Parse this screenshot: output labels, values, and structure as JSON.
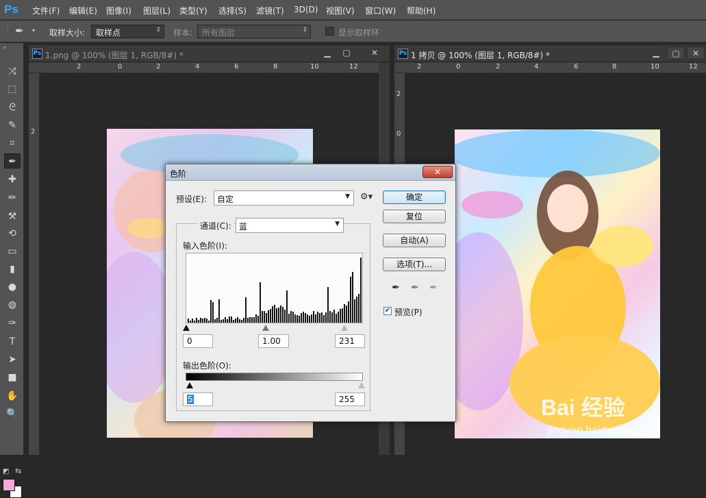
{
  "app": {
    "logo": "Ps"
  },
  "menu": [
    "文件(F)",
    "编辑(E)",
    "图像(I)",
    "图层(L)",
    "类型(Y)",
    "选择(S)",
    "滤镜(T)",
    "3D(D)",
    "视图(V)",
    "窗口(W)",
    "帮助(H)"
  ],
  "options": {
    "sample_size_label": "取样大小:",
    "sample_size_value": "取样点",
    "sample_label": "样本:",
    "sample_value": "所有图层",
    "show_ring_label": "显示取样环"
  },
  "tools": [
    "move-tool",
    "marquee-tool",
    "lasso-tool",
    "quick-select-tool",
    "crop-tool",
    "eyedropper-tool",
    "healing-brush-tool",
    "brush-tool",
    "clone-stamp-tool",
    "history-brush-tool",
    "eraser-tool",
    "gradient-tool",
    "blur-tool",
    "dodge-tool",
    "pen-tool",
    "type-tool",
    "path-select-tool",
    "rectangle-tool",
    "hand-tool",
    "zoom-tool"
  ],
  "tool_glyphs": [
    "⤨",
    "⬚",
    "ᘓ",
    "✎",
    "⌗",
    "✒",
    "✚",
    "✏",
    "⚒",
    "⟲",
    "▭",
    "▮",
    "●",
    "◍",
    "✑",
    "T",
    "➤",
    "■",
    "✋",
    "🔍"
  ],
  "type_tool_letter": "T",
  "documents": [
    {
      "title": "1.png @ 100% (图层 1, RGB/8#) *",
      "ruler_ticks": [
        "2",
        "0",
        "2",
        "4",
        "6",
        "8",
        "10",
        "12"
      ],
      "vruler_ticks": [
        "2"
      ]
    },
    {
      "title": "1 拷贝 @ 100% (图层 1, RGB/8#) *",
      "ruler_ticks": [
        "2",
        "0",
        "2",
        "4",
        "6",
        "8",
        "10",
        "12"
      ],
      "vruler_ticks": [
        "2",
        "0"
      ]
    }
  ],
  "levels_dialog": {
    "title": "色阶",
    "close": "✕",
    "preset_label": "预设(E):",
    "preset_value": "自定",
    "channel_label": "通道(C):",
    "channel_value": "蓝",
    "input_label": "输入色阶(I):",
    "input_black": "0",
    "input_gamma": "1.00",
    "input_white": "231",
    "output_label": "输出色阶(O):",
    "output_black": "5",
    "output_white": "255",
    "buttons": {
      "ok": "确定",
      "reset": "复位",
      "auto": "自动(A)",
      "options": "选项(T)..."
    },
    "preview_label": "预览(P)",
    "preview_checked": true
  },
  "watermark": {
    "brand": "Bai 经验",
    "url": "jingyan.baidu.com"
  },
  "colors": {
    "accent": "#31a8ff",
    "foreground_swatch": "#f4a7d8",
    "background_swatch": "#ffffff"
  }
}
